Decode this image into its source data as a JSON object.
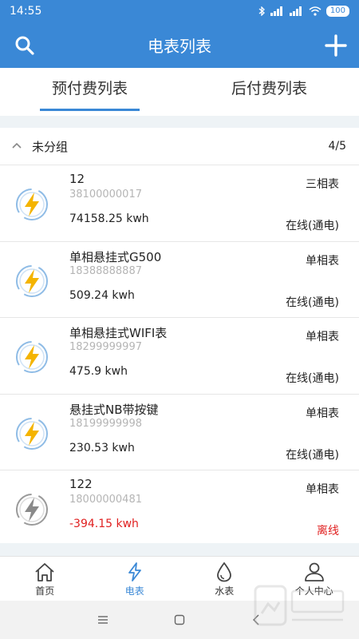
{
  "status_bar": {
    "time": "14:55",
    "battery": "100"
  },
  "header": {
    "title": "电表列表"
  },
  "tabs": [
    {
      "label": "预付费列表",
      "active": true
    },
    {
      "label": "后付费列表",
      "active": false
    }
  ],
  "group": {
    "name": "未分组",
    "count": "4/5"
  },
  "meters": [
    {
      "name": "12",
      "id": "38100000017",
      "kwh": "74158.25 kwh",
      "type": "三相表",
      "status": "在线(通电)",
      "online": true
    },
    {
      "name": "单相悬挂式G500",
      "id": "18388888887",
      "kwh": "509.24 kwh",
      "type": "单相表",
      "status": "在线(通电)",
      "online": true
    },
    {
      "name": "单相悬挂式WIFI表",
      "id": "18299999997",
      "kwh": "475.9 kwh",
      "type": "单相表",
      "status": "在线(通电)",
      "online": true
    },
    {
      "name": "悬挂式NB带按键",
      "id": "18199999998",
      "kwh": "230.53 kwh",
      "type": "单相表",
      "status": "在线(通电)",
      "online": true
    },
    {
      "name": "122",
      "id": "18000000481",
      "kwh": "-394.15 kwh",
      "type": "单相表",
      "status": "离线",
      "online": false
    }
  ],
  "nav": [
    {
      "label": "首页",
      "icon": "home-icon"
    },
    {
      "label": "电表",
      "icon": "lightning-icon",
      "active": true
    },
    {
      "label": "水表",
      "icon": "water-drop-icon"
    },
    {
      "label": "个人中心",
      "icon": "user-icon"
    }
  ],
  "colors": {
    "primary": "#3a88d6",
    "danger": "#e02020",
    "bolt": "#f4b400",
    "online_ring": "#8fbce6",
    "offline_ring": "#9a9a9a"
  }
}
